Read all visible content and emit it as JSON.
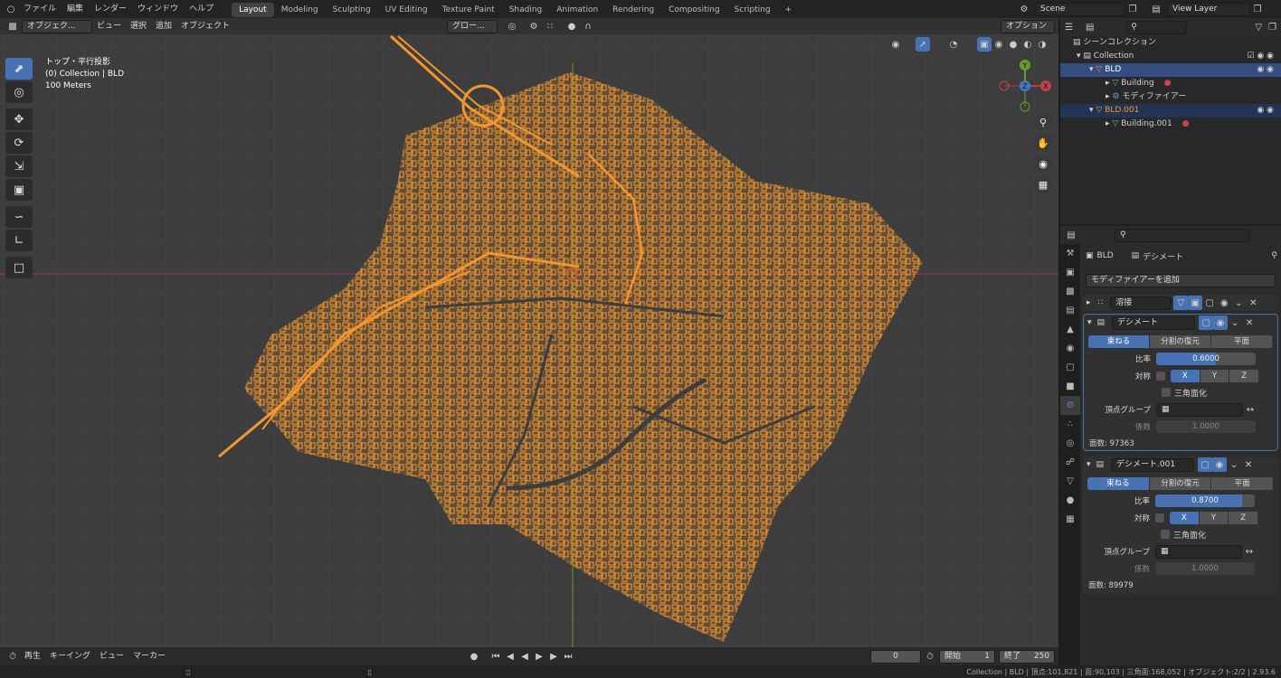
{
  "topbar": {
    "menus": [
      "ファイル",
      "編集",
      "レンダー",
      "ウィンドウ",
      "ヘルプ"
    ],
    "workspaces": [
      "Layout",
      "Modeling",
      "Sculpting",
      "UV Editing",
      "Texture Paint",
      "Shading",
      "Animation",
      "Rendering",
      "Compositing",
      "Scripting"
    ],
    "active_workspace": "Layout",
    "add_tab": "+",
    "scene": "Scene",
    "view_layer": "View Layer"
  },
  "viewport": {
    "mode": "オブジェク...",
    "menus": [
      "ビュー",
      "選択",
      "追加",
      "オブジェクト"
    ],
    "transform": "グロー...",
    "options": "オプション",
    "overlay_line1": "トップ・平行投影",
    "overlay_line2": "(0) Collection | BLD",
    "overlay_line3": "100 Meters",
    "gizmo": {
      "y": "Y",
      "x": "X",
      "z": "Z"
    },
    "accent_color": "#f2962d",
    "x_axis_color": "#9c3a46",
    "y_axis_color": "#6a9a2b"
  },
  "outliner": {
    "scene_collection": "シーンコレクション",
    "collection": "Collection",
    "obj1": "BLD",
    "mesh1": "Building",
    "modifier": "モディファイアー",
    "obj2": "BLD.001",
    "mesh2": "Building.001"
  },
  "properties": {
    "object_name": "BLD",
    "modifier_name": "デシメート",
    "add_modifier": "モディファイアーを追加",
    "weld": {
      "name": "溶接"
    },
    "decimate1": {
      "name": "デシメート",
      "tabs": [
        "束ねる",
        "分割の復元",
        "平面"
      ],
      "ratio_label": "比率",
      "ratio": "0.6000",
      "ratio_fraction": 0.6,
      "symmetry_label": "対称",
      "axes": [
        "X",
        "Y",
        "Z"
      ],
      "triangulate": "三角面化",
      "vgroup_label": "頂点グループ",
      "factor_label": "係数",
      "factor": "1.0000",
      "faces": "面数: 97363"
    },
    "decimate2": {
      "name": "デシメート.001",
      "tabs": [
        "束ねる",
        "分割の復元",
        "平面"
      ],
      "ratio_label": "比率",
      "ratio": "0.8700",
      "ratio_fraction": 0.87,
      "symmetry_label": "対称",
      "axes": [
        "X",
        "Y",
        "Z"
      ],
      "triangulate": "三角面化",
      "vgroup_label": "頂点グループ",
      "factor_label": "係数",
      "factor": "1.0000",
      "faces": "面数: 89979"
    }
  },
  "timeline": {
    "playback": "再生",
    "keying": "キーイング",
    "view": "ビュー",
    "marker": "マーカー",
    "current_frame": "0",
    "start_label": "開始",
    "start": "1",
    "end_label": "終了",
    "end": "250"
  },
  "statusbar": {
    "text": "Collection | BLD | 頂点:101,821 | 面:90,103 | 三角面:168,052 | オブジェクト:2/2 | 2.93.6"
  }
}
